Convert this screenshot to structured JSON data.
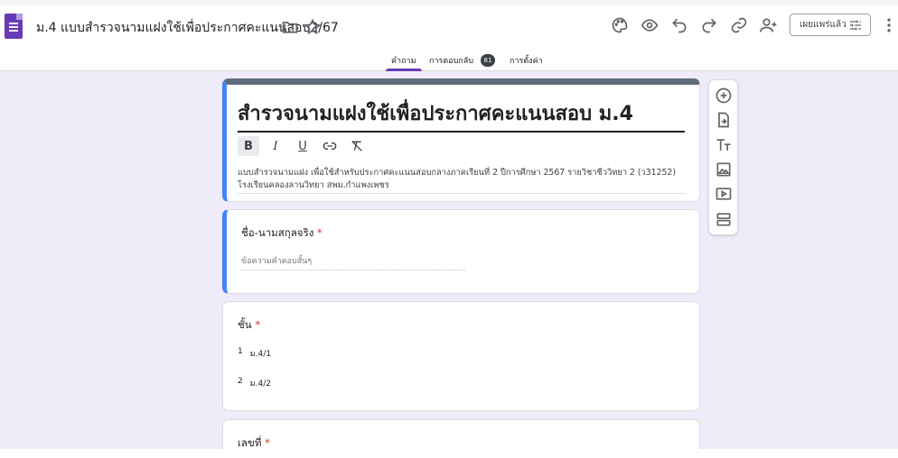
{
  "header": {
    "doc_title": "ม.4 แบบสำรวจนามแฝงใช้เพื่อประกาศคะแนนสอบ2/67",
    "publish_label": "เผยแพร่แล้ว"
  },
  "tabs": [
    {
      "label": "คำถาม",
      "active": true
    },
    {
      "label": "การตอบกลับ",
      "count": "81"
    },
    {
      "label": "การตั้งค่า"
    }
  ],
  "form": {
    "title": "สำรวจนามแฝงใช้เพื่อประกาศคะแนนสอบ ม.4",
    "description_line1": "แบบสำรวจนามแฝง เพื่อใช้สำหรับประกาศคะแนนสอบกลางภาคเรียนที่ 2 ปีการศึกษา 2567 รายวิชาชีววิทยา 2 (ว31252)",
    "description_line2": "โรงเรียนคลองลานวิทยา สพม.กำแพงเพชร",
    "format_buttons": [
      "B",
      "I",
      "U",
      "link",
      "clear"
    ]
  },
  "questions": [
    {
      "title": "ชื่อ-นามสกุลจริง",
      "required": "*",
      "placeholder": "ข้อความคำตอบสั้นๆ"
    },
    {
      "title": "ชั้น",
      "required": "*",
      "options": [
        {
          "num": "1",
          "label": "ม.4/1"
        },
        {
          "num": "2",
          "label": "ม.4/2"
        }
      ]
    },
    {
      "title": "เลขที่",
      "required": "*"
    }
  ],
  "icons": {
    "header": [
      "folder-icon",
      "star-icon",
      "palette-icon",
      "eye-icon",
      "undo-icon",
      "redo-icon",
      "link-icon",
      "add-person-icon",
      "tune-icon",
      "more-vert-icon"
    ],
    "side_toolbar": [
      "add-question-icon",
      "import-questions-icon",
      "add-title-icon",
      "add-image-icon",
      "add-video-icon",
      "add-section-icon"
    ]
  },
  "colors": {
    "accent": "#673ab7",
    "selected": "#4285f4",
    "background": "#f0ebf8",
    "required": "#d93025"
  }
}
